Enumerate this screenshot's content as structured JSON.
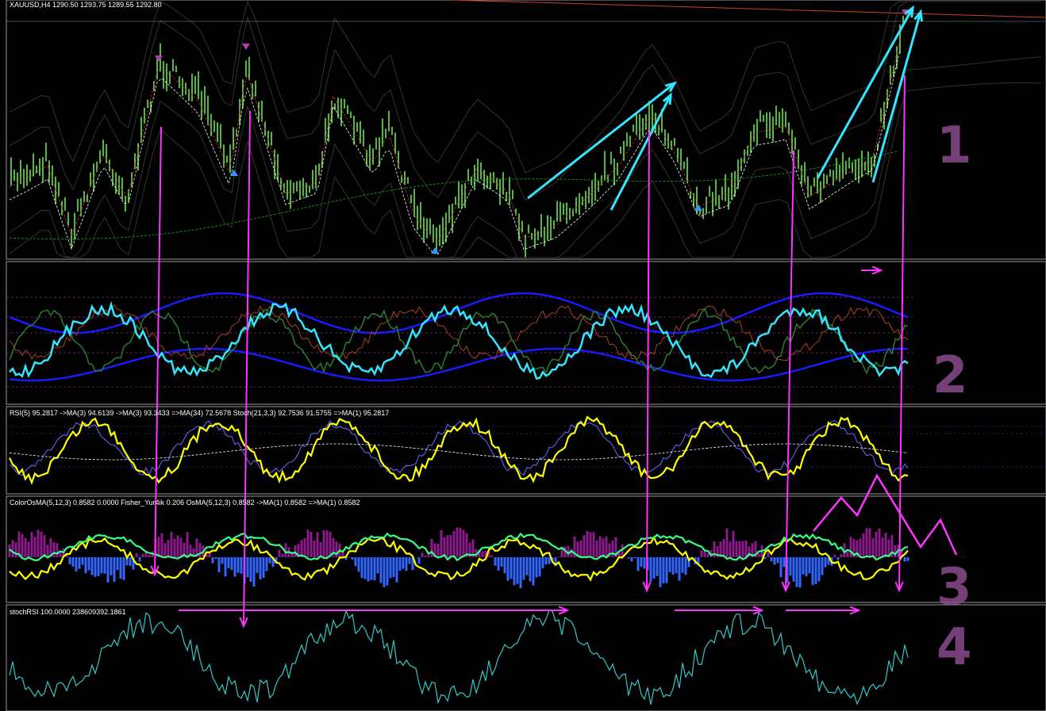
{
  "window": {
    "symbol_header": "XAUUSD,H4  1290.50 1293.75 1289.55 1292.80"
  },
  "colors": {
    "background": "#000000",
    "candle": "#66e84a",
    "annotation_cyan": "#33e6ff",
    "annotation_magenta": "#ff33ff",
    "rsi_yellow": "#ffff00",
    "osma_green": "#33ff88",
    "band_blue": "#1a1aff",
    "stoch_cyan": "#33c9c9",
    "hist_purple": "#8b1a8b",
    "hist_blue": "#3366ff",
    "marker_blue": "#3399ff",
    "marker_purple": "#b040b0"
  },
  "chart_data": [
    {
      "type": "line",
      "name": "price",
      "title": "XAUUSD,H4  1290.50 1293.75 1289.55 1292.80",
      "description_markers": [
        "arrow-up",
        "arrow-down"
      ],
      "annotation": "1"
    },
    {
      "type": "line",
      "name": "indicator-panel-2",
      "annotation": "2"
    },
    {
      "type": "line",
      "name": "rsi-stoch",
      "legend": "RSI(5) 95.2817  ->MA(3) 94.6139  ->MA(3) 93.3433  =>MA(34) 72.5678  Stoch(21,3,3) 92.7536 91.5755  =>MA(1) 95.2817"
    },
    {
      "type": "bar",
      "name": "osma",
      "legend": "ColorOsMA(5,12,3) 0.8582 0.0000  Fisher_Yur4ik 0.206  OsMA(5,12,3) 0.8582  ->MA(1) 0.8582  =>MA(1) 0.8582",
      "annotation": "3"
    },
    {
      "type": "line",
      "name": "stoch-rsi",
      "legend": "stochRSI 100.0000 238609392.1861",
      "annotation": "4"
    }
  ]
}
